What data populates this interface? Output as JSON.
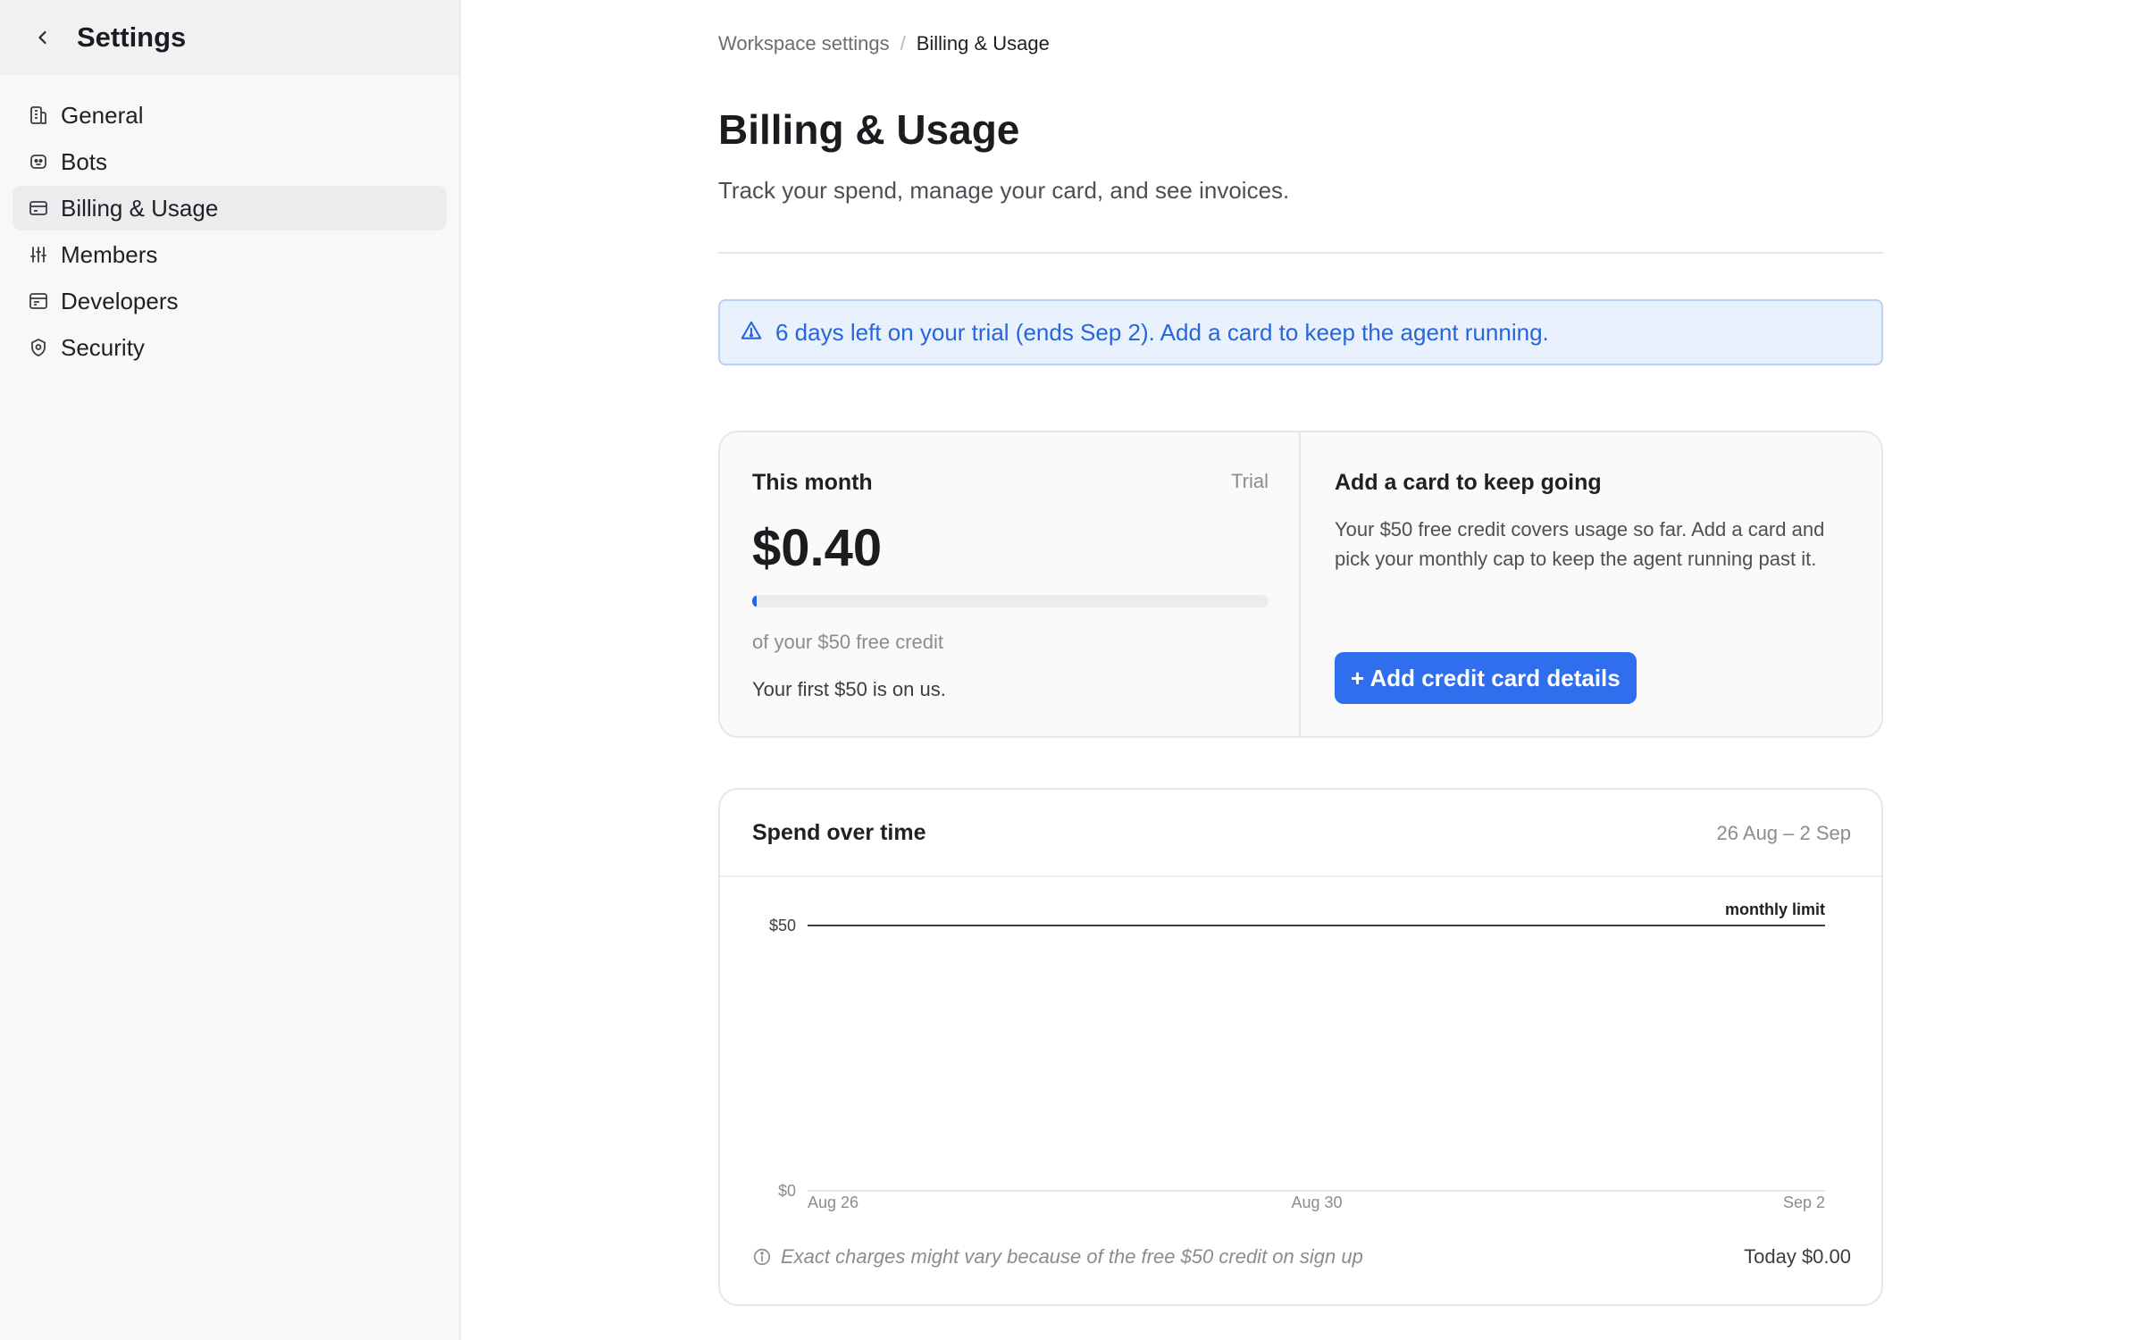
{
  "sidebar": {
    "title": "Settings",
    "items": [
      {
        "label": "General",
        "icon": "building-icon"
      },
      {
        "label": "Bots",
        "icon": "bot-icon"
      },
      {
        "label": "Billing & Usage",
        "icon": "credit-card-icon",
        "active": true
      },
      {
        "label": "Members",
        "icon": "sliders-icon"
      },
      {
        "label": "Developers",
        "icon": "code-window-icon"
      },
      {
        "label": "Security",
        "icon": "shield-icon"
      }
    ]
  },
  "breadcrumb": {
    "parent": "Workspace settings",
    "separator": "/",
    "current": "Billing & Usage"
  },
  "page": {
    "title": "Billing & Usage",
    "subtitle": "Track your spend, manage your card, and see invoices."
  },
  "banner": {
    "text": "6 days left on your trial (ends Sep 2). Add a card to keep the agent running.",
    "icon": "warning-triangle-icon",
    "color": "#2766d9"
  },
  "this_month": {
    "label": "This month",
    "badge": "Trial",
    "amount": "$0.40",
    "progress_fraction": 0.008,
    "credit_caption": "of your $50 free credit",
    "note": "Your first $50 is on us."
  },
  "add_card": {
    "title": "Add a card to keep going",
    "description": "Your $50 free credit covers usage so far. Add a card and pick your monthly cap to keep the agent running past it.",
    "button_label": "+ Add credit card details"
  },
  "spend_chart": {
    "title": "Spend over time",
    "range": "26 Aug – 2 Sep",
    "footer_note": "Exact charges might vary because of the free $50 credit on sign up",
    "today": "Today $0.00"
  },
  "chart_data": {
    "type": "line",
    "x_ticks": [
      "Aug 26",
      "Aug 30",
      "Sep 2"
    ],
    "y_ticks": [
      "$0",
      "$50"
    ],
    "ylim": [
      0,
      50
    ],
    "series": [],
    "reference_lines": [
      {
        "label": "monthly limit",
        "value": 50
      }
    ],
    "grid": false
  },
  "colors": {
    "accent": "#2f6fee",
    "banner_bg": "#e9f1fd"
  }
}
